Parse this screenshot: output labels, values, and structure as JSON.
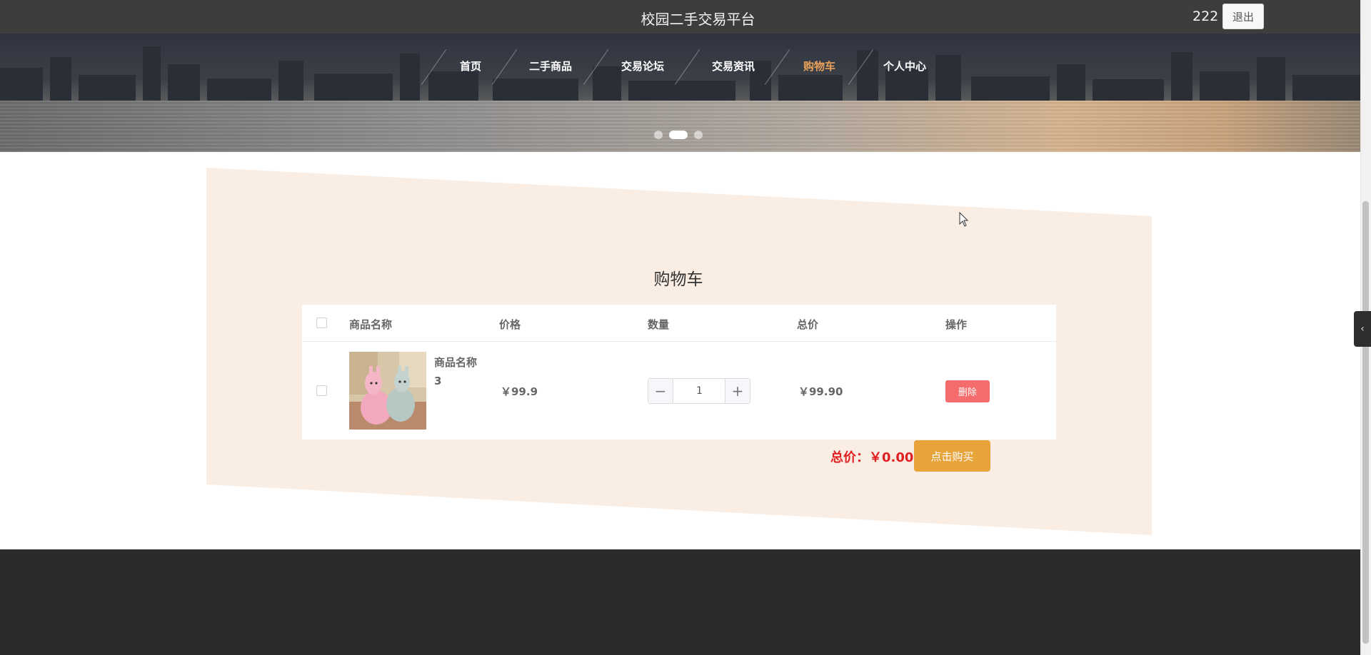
{
  "header": {
    "site_title": "校园二手交易平台",
    "username": "222",
    "logout_label": "退出"
  },
  "nav": {
    "items": [
      {
        "label": "首页",
        "active": false
      },
      {
        "label": "二手商品",
        "active": false
      },
      {
        "label": "交易论坛",
        "active": false
      },
      {
        "label": "交易资讯",
        "active": false
      },
      {
        "label": "购物车",
        "active": true
      },
      {
        "label": "个人中心",
        "active": false
      }
    ],
    "active_color": "#e8a05a"
  },
  "carousel": {
    "slide_count": 3,
    "active_index": 1
  },
  "cart": {
    "title": "购物车",
    "columns": [
      "商品名称",
      "价格",
      "数量",
      "总价",
      "操作"
    ],
    "rows": [
      {
        "name": "商品名称3",
        "name_line1": "商品名称",
        "name_line2": "3",
        "price": "￥99.9",
        "quantity": "1",
        "subtotal": "￥99.90",
        "delete_label": "删除",
        "selected": false
      }
    ],
    "total_label": "总价：￥0.00",
    "buy_label": "点击购买"
  },
  "colors": {
    "topbar": "#3d3d3d",
    "panel_bg": "#faeee4",
    "delete": "#f56c6c",
    "buy": "#e8a43a",
    "total_text": "#e02020",
    "footer": "#2b2b2b"
  },
  "icons": {
    "stepper_minus": "minus-icon",
    "stepper_plus": "plus-icon",
    "side_toggle": "chevron-left-icon"
  }
}
